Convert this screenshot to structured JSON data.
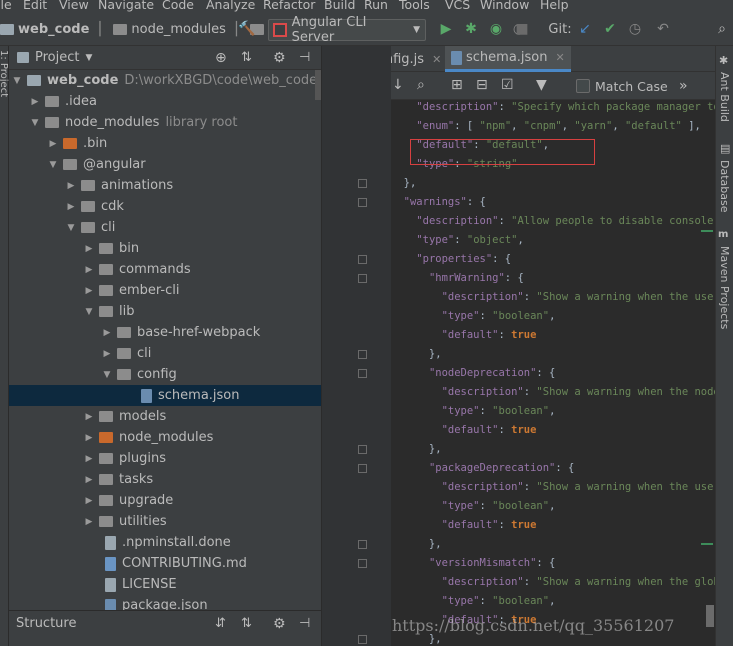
{
  "menu": [
    "ile",
    "Edit",
    "View",
    "Navigate",
    "Code",
    "Analyze",
    "Refactor",
    "Build",
    "Run",
    "Tools",
    "VCS",
    "Window",
    "Help"
  ],
  "breadcrumb": {
    "project": "web_code",
    "folder1": "node_modules",
    "folder2": "@"
  },
  "run_config": "Angular CLI Server",
  "git_label": "Git:",
  "project_panel": {
    "title": "Project",
    "root_name": "web_code",
    "root_path": "D:\\workXBGD\\code\\web_code",
    "items": [
      {
        "label": "web_code",
        "extra": "D:\\workXBGD\\code\\web_code"
      },
      {
        "label": ".idea",
        "extra": ""
      },
      {
        "label": "node_modules",
        "extra": "library root"
      },
      {
        "label": ".bin",
        "extra": ""
      },
      {
        "label": "@angular",
        "extra": ""
      },
      {
        "label": "animations",
        "extra": ""
      },
      {
        "label": "cdk",
        "extra": ""
      },
      {
        "label": "cli",
        "extra": ""
      },
      {
        "label": "bin",
        "extra": ""
      },
      {
        "label": "commands",
        "extra": ""
      },
      {
        "label": "ember-cli",
        "extra": ""
      },
      {
        "label": "lib",
        "extra": ""
      },
      {
        "label": "base-href-webpack",
        "extra": ""
      },
      {
        "label": "cli",
        "extra": ""
      },
      {
        "label": "config",
        "extra": ""
      },
      {
        "label": "schema.json",
        "extra": ""
      },
      {
        "label": "models",
        "extra": ""
      },
      {
        "label": "node_modules",
        "extra": ""
      },
      {
        "label": "plugins",
        "extra": ""
      },
      {
        "label": "tasks",
        "extra": ""
      },
      {
        "label": "upgrade",
        "extra": ""
      },
      {
        "label": "utilities",
        "extra": ""
      },
      {
        "label": ".npminstall.done",
        "extra": ""
      },
      {
        "label": "CONTRIBUTING.md",
        "extra": ""
      },
      {
        "label": "LICENSE",
        "extra": ""
      },
      {
        "label": "package.json",
        "extra": ""
      }
    ]
  },
  "structure_panel": {
    "title": "Structure"
  },
  "tabs": [
    {
      "label": "apiConfig.js"
    },
    {
      "label": "schema.json"
    }
  ],
  "find_bar": {
    "match_case_label": "Match Case"
  },
  "right_tools": [
    "Ant Build",
    "Database",
    "Maven Projects"
  ],
  "left_tools": [
    "1: Project"
  ],
  "code_lines": [
    "    \"description\": \"Specify which package manager too",
    "    \"enum\": [ \"npm\", \"cnpm\", \"yarn\", \"default\" ],",
    "    \"default\": \"default\",",
    "    \"type\": \"string\"",
    "  },",
    "  \"warnings\": {",
    "    \"description\": \"Allow people to disable console warn",
    "    \"type\": \"object\",",
    "    \"properties\": {",
    "      \"hmrWarning\": {",
    "        \"description\": \"Show a warning when the user ena",
    "        \"type\": \"boolean\",",
    "        \"default\": true",
    "      },",
    "      \"nodeDeprecation\": {",
    "        \"description\": \"Show a warning when the node ver",
    "        \"type\": \"boolean\",",
    "        \"default\": true",
    "      },",
    "      \"packageDeprecation\": {",
    "        \"description\": \"Show a warning when the user ins",
    "        \"type\": \"boolean\",",
    "        \"default\": true",
    "      },",
    "      \"versionMismatch\": {",
    "        \"description\": \"Show a warning when the global v",
    "        \"type\": \"boolean\",",
    "        \"default\": true",
    "      },"
  ],
  "watermark": "https://blog.csdn.net/qq_35561207"
}
